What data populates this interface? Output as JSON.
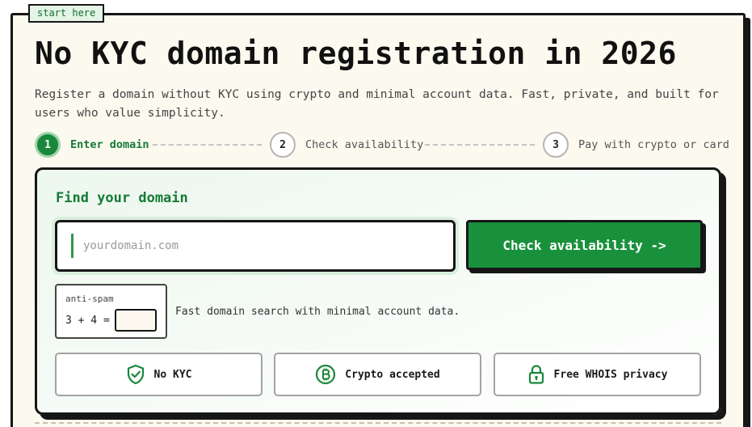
{
  "start_tag": "start here",
  "header": {
    "title": "No KYC domain registration in 2026",
    "subtitle": "Register a domain without KYC using crypto and minimal account data. Fast, private, and built for users who value simplicity."
  },
  "steps": [
    {
      "number": "1",
      "label": "Enter domain",
      "active": true
    },
    {
      "number": "2",
      "label": "Check availability",
      "active": false
    },
    {
      "number": "3",
      "label": "Pay with crypto or card",
      "active": false
    }
  ],
  "search": {
    "title": "Find your domain",
    "placeholder": "yourdomain.com",
    "value": "",
    "button_label": "Check availability ->"
  },
  "antispam": {
    "label": "anti-spam",
    "question": "3 + 4 =",
    "answer": "",
    "note": "Fast domain search with minimal account data."
  },
  "features": [
    {
      "icon": "shield-check-icon",
      "label": "No KYC"
    },
    {
      "icon": "bitcoin-coin-icon",
      "label": "Crypto accepted"
    },
    {
      "icon": "padlock-icon",
      "label": "Free WHOIS privacy"
    }
  ],
  "colors": {
    "accent_green": "#19913c",
    "text_green": "#167a35",
    "panel_background": "#fcf9ef",
    "border_dark": "#161616"
  }
}
